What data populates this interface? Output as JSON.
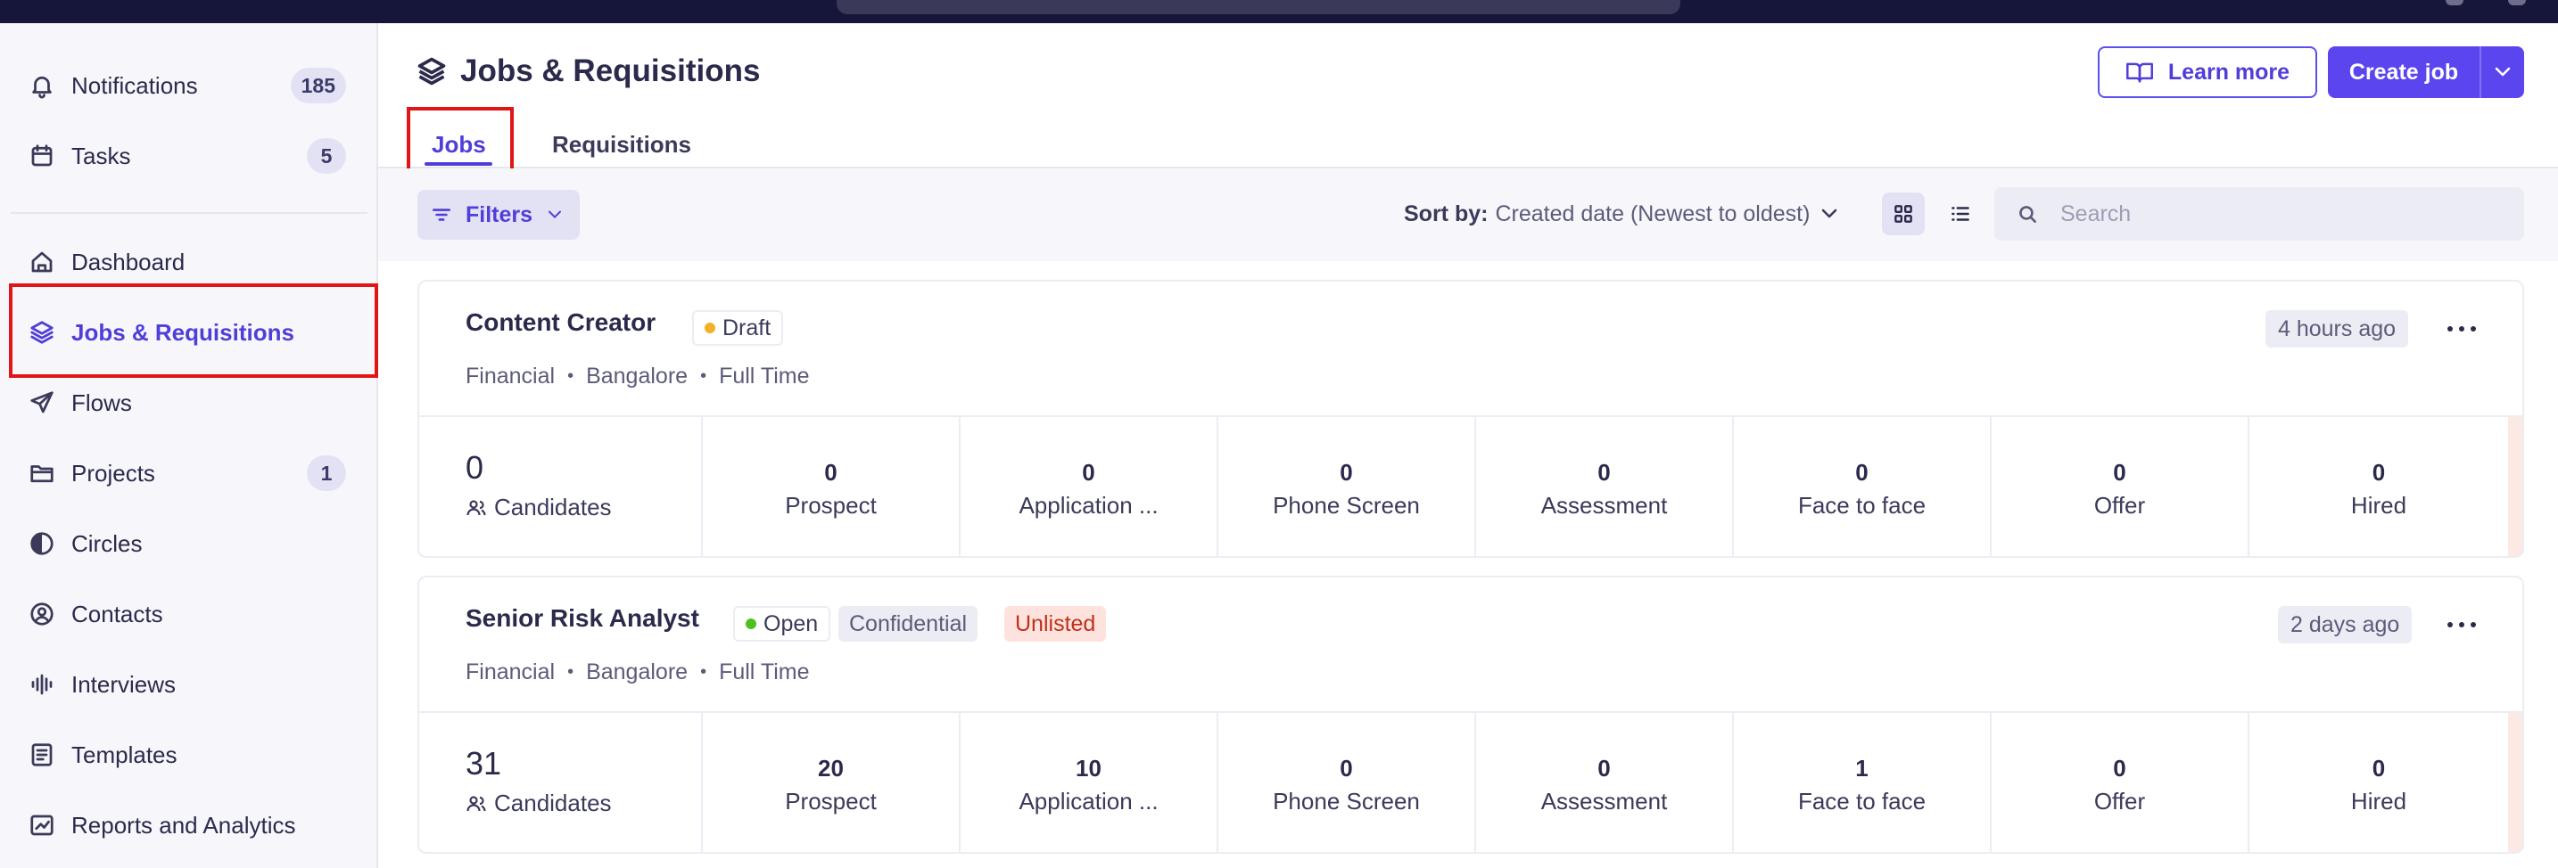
{
  "sidebar": {
    "items": [
      {
        "label": "Notifications",
        "icon": "bell-icon",
        "badge": "185"
      },
      {
        "label": "Tasks",
        "icon": "calendar-icon",
        "badge": "5"
      },
      {
        "label": "Dashboard",
        "icon": "home-icon"
      },
      {
        "label": "Jobs & Requisitions",
        "icon": "layers-icon",
        "active": true
      },
      {
        "label": "Flows",
        "icon": "send-icon"
      },
      {
        "label": "Projects",
        "icon": "folder-icon",
        "badge": "1"
      },
      {
        "label": "Circles",
        "icon": "circle-half-icon"
      },
      {
        "label": "Contacts",
        "icon": "user-circle-icon"
      },
      {
        "label": "Interviews",
        "icon": "audio-wave-icon"
      },
      {
        "label": "Templates",
        "icon": "template-icon"
      },
      {
        "label": "Reports and Analytics",
        "icon": "chart-icon"
      }
    ]
  },
  "header": {
    "title": "Jobs & Requisitions",
    "learn_more": "Learn more",
    "create_job": "Create job"
  },
  "tabs": [
    {
      "label": "Jobs",
      "active": true
    },
    {
      "label": "Requisitions",
      "active": false
    }
  ],
  "toolbar": {
    "filters": "Filters",
    "sort_key": "Sort by:",
    "sort_value": "Created date (Newest to oldest)",
    "search_placeholder": "Search"
  },
  "jobs": [
    {
      "title": "Content Creator",
      "status": "Draft",
      "status_color": "#f5b027",
      "tags": [],
      "department": "Financial",
      "location": "Bangalore",
      "type": "Full Time",
      "time_ago": "4 hours ago",
      "candidates": "0",
      "candidates_label": "Candidates",
      "stages": [
        {
          "count": "0",
          "label": "Prospect"
        },
        {
          "count": "0",
          "label": "Application ..."
        },
        {
          "count": "0",
          "label": "Phone Screen"
        },
        {
          "count": "0",
          "label": "Assessment"
        },
        {
          "count": "0",
          "label": "Face to face"
        },
        {
          "count": "0",
          "label": "Offer"
        },
        {
          "count": "0",
          "label": "Hired"
        }
      ]
    },
    {
      "title": "Senior Risk Analyst",
      "status": "Open",
      "status_color": "#4cc21f",
      "tags": [
        "Confidential",
        "Unlisted"
      ],
      "department": "Financial",
      "location": "Bangalore",
      "type": "Full Time",
      "time_ago": "2 days ago",
      "candidates": "31",
      "candidates_label": "Candidates",
      "stages": [
        {
          "count": "20",
          "label": "Prospect"
        },
        {
          "count": "10",
          "label": "Application ..."
        },
        {
          "count": "0",
          "label": "Phone Screen"
        },
        {
          "count": "0",
          "label": "Assessment"
        },
        {
          "count": "1",
          "label": "Face to face"
        },
        {
          "count": "0",
          "label": "Offer"
        },
        {
          "count": "0",
          "label": "Hired"
        }
      ]
    }
  ],
  "colors": {
    "accent": "#4f3ed9",
    "highlight": "#e01616"
  }
}
